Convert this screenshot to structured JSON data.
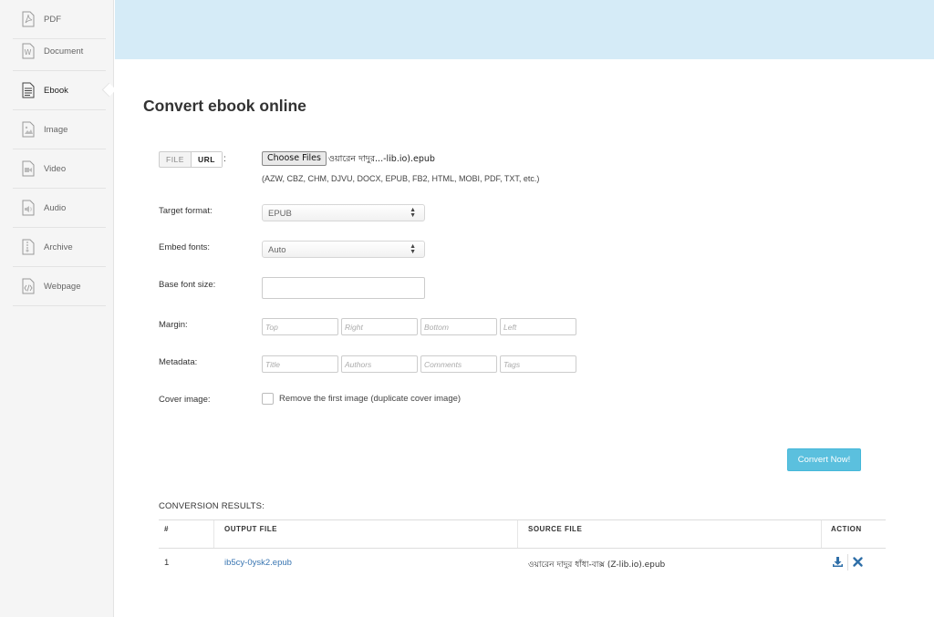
{
  "sidebar": {
    "items": [
      {
        "label": "PDF",
        "icon": "pdf-icon"
      },
      {
        "label": "Document",
        "icon": "word-document-icon"
      },
      {
        "label": "Ebook",
        "icon": "ebook-icon",
        "active": true
      },
      {
        "label": "Image",
        "icon": "image-icon"
      },
      {
        "label": "Video",
        "icon": "video-icon"
      },
      {
        "label": "Audio",
        "icon": "audio-icon"
      },
      {
        "label": "Archive",
        "icon": "archive-icon"
      },
      {
        "label": "Webpage",
        "icon": "webpage-icon"
      }
    ]
  },
  "page": {
    "title": "Convert ebook online"
  },
  "form": {
    "source_toggle": {
      "file": "FILE",
      "url": "URL",
      "colon": ":"
    },
    "choose_files_label": "Choose Files",
    "selected_file": "ওয়ারেন দাদুর...-lib.io).epub",
    "supported_formats": "(AZW, CBZ, CHM, DJVU, DOCX, EPUB, FB2, HTML, MOBI, PDF, TXT, etc.)",
    "target_format": {
      "label": "Target format:",
      "value": "EPUB"
    },
    "embed_fonts": {
      "label": "Embed fonts:",
      "value": "Auto"
    },
    "base_font_size": {
      "label": "Base font size:",
      "value": ""
    },
    "margin": {
      "label": "Margin:",
      "placeholders": [
        "Top",
        "Right",
        "Bottom",
        "Left"
      ]
    },
    "metadata": {
      "label": "Metadata:",
      "placeholders": [
        "Title",
        "Authors",
        "Comments",
        "Tags"
      ]
    },
    "cover_image": {
      "label": "Cover image:",
      "checkbox_label": "Remove the first image (duplicate cover image)",
      "checked": false
    },
    "convert_button": "Convert Now!"
  },
  "results": {
    "title": "CONVERSION RESULTS:",
    "headers": {
      "index": "#",
      "output": "OUTPUT FILE",
      "source": "SOURCE FILE",
      "action": "ACTION"
    },
    "rows": [
      {
        "index": "1",
        "output": "ib5cy-0ysk2.epub",
        "source": "ওয়ারেন দাদুর ধাঁধা-বাক্স (Z-lib.io).epub"
      }
    ]
  },
  "colors": {
    "banner": "#d5ebf7",
    "accent_button": "#5bc0de",
    "link": "#3a76b2",
    "sidebar_bg": "#f5f5f5"
  }
}
